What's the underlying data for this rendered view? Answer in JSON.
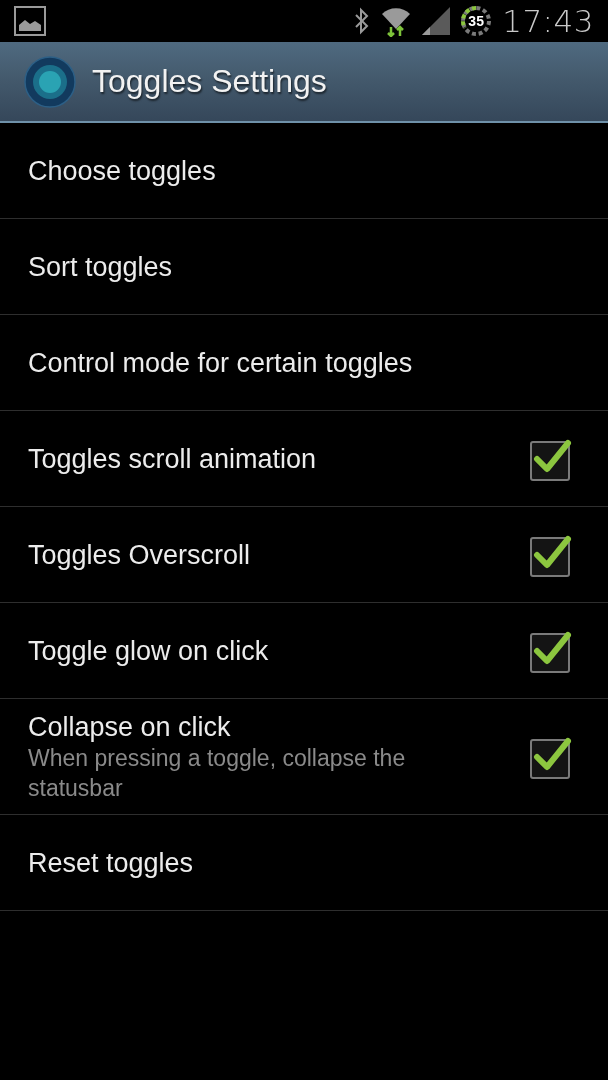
{
  "status_bar": {
    "battery": "35",
    "time": "17:43"
  },
  "action_bar": {
    "title": "Toggles Settings"
  },
  "preferences": [
    {
      "kind": "item",
      "title": "Choose toggles"
    },
    {
      "kind": "item",
      "title": "Sort toggles"
    },
    {
      "kind": "item",
      "title": "Control mode for certain toggles"
    },
    {
      "kind": "checkbox",
      "title": "Toggles scroll animation",
      "checked": true
    },
    {
      "kind": "checkbox",
      "title": "Toggles Overscroll",
      "checked": true
    },
    {
      "kind": "checkbox",
      "title": "Toggle glow on click",
      "checked": true
    },
    {
      "kind": "checkbox",
      "title": "Collapse on click",
      "summary": "When pressing a toggle, collapse the statusbar",
      "checked": true
    },
    {
      "kind": "item",
      "title": "Reset toggles"
    }
  ]
}
